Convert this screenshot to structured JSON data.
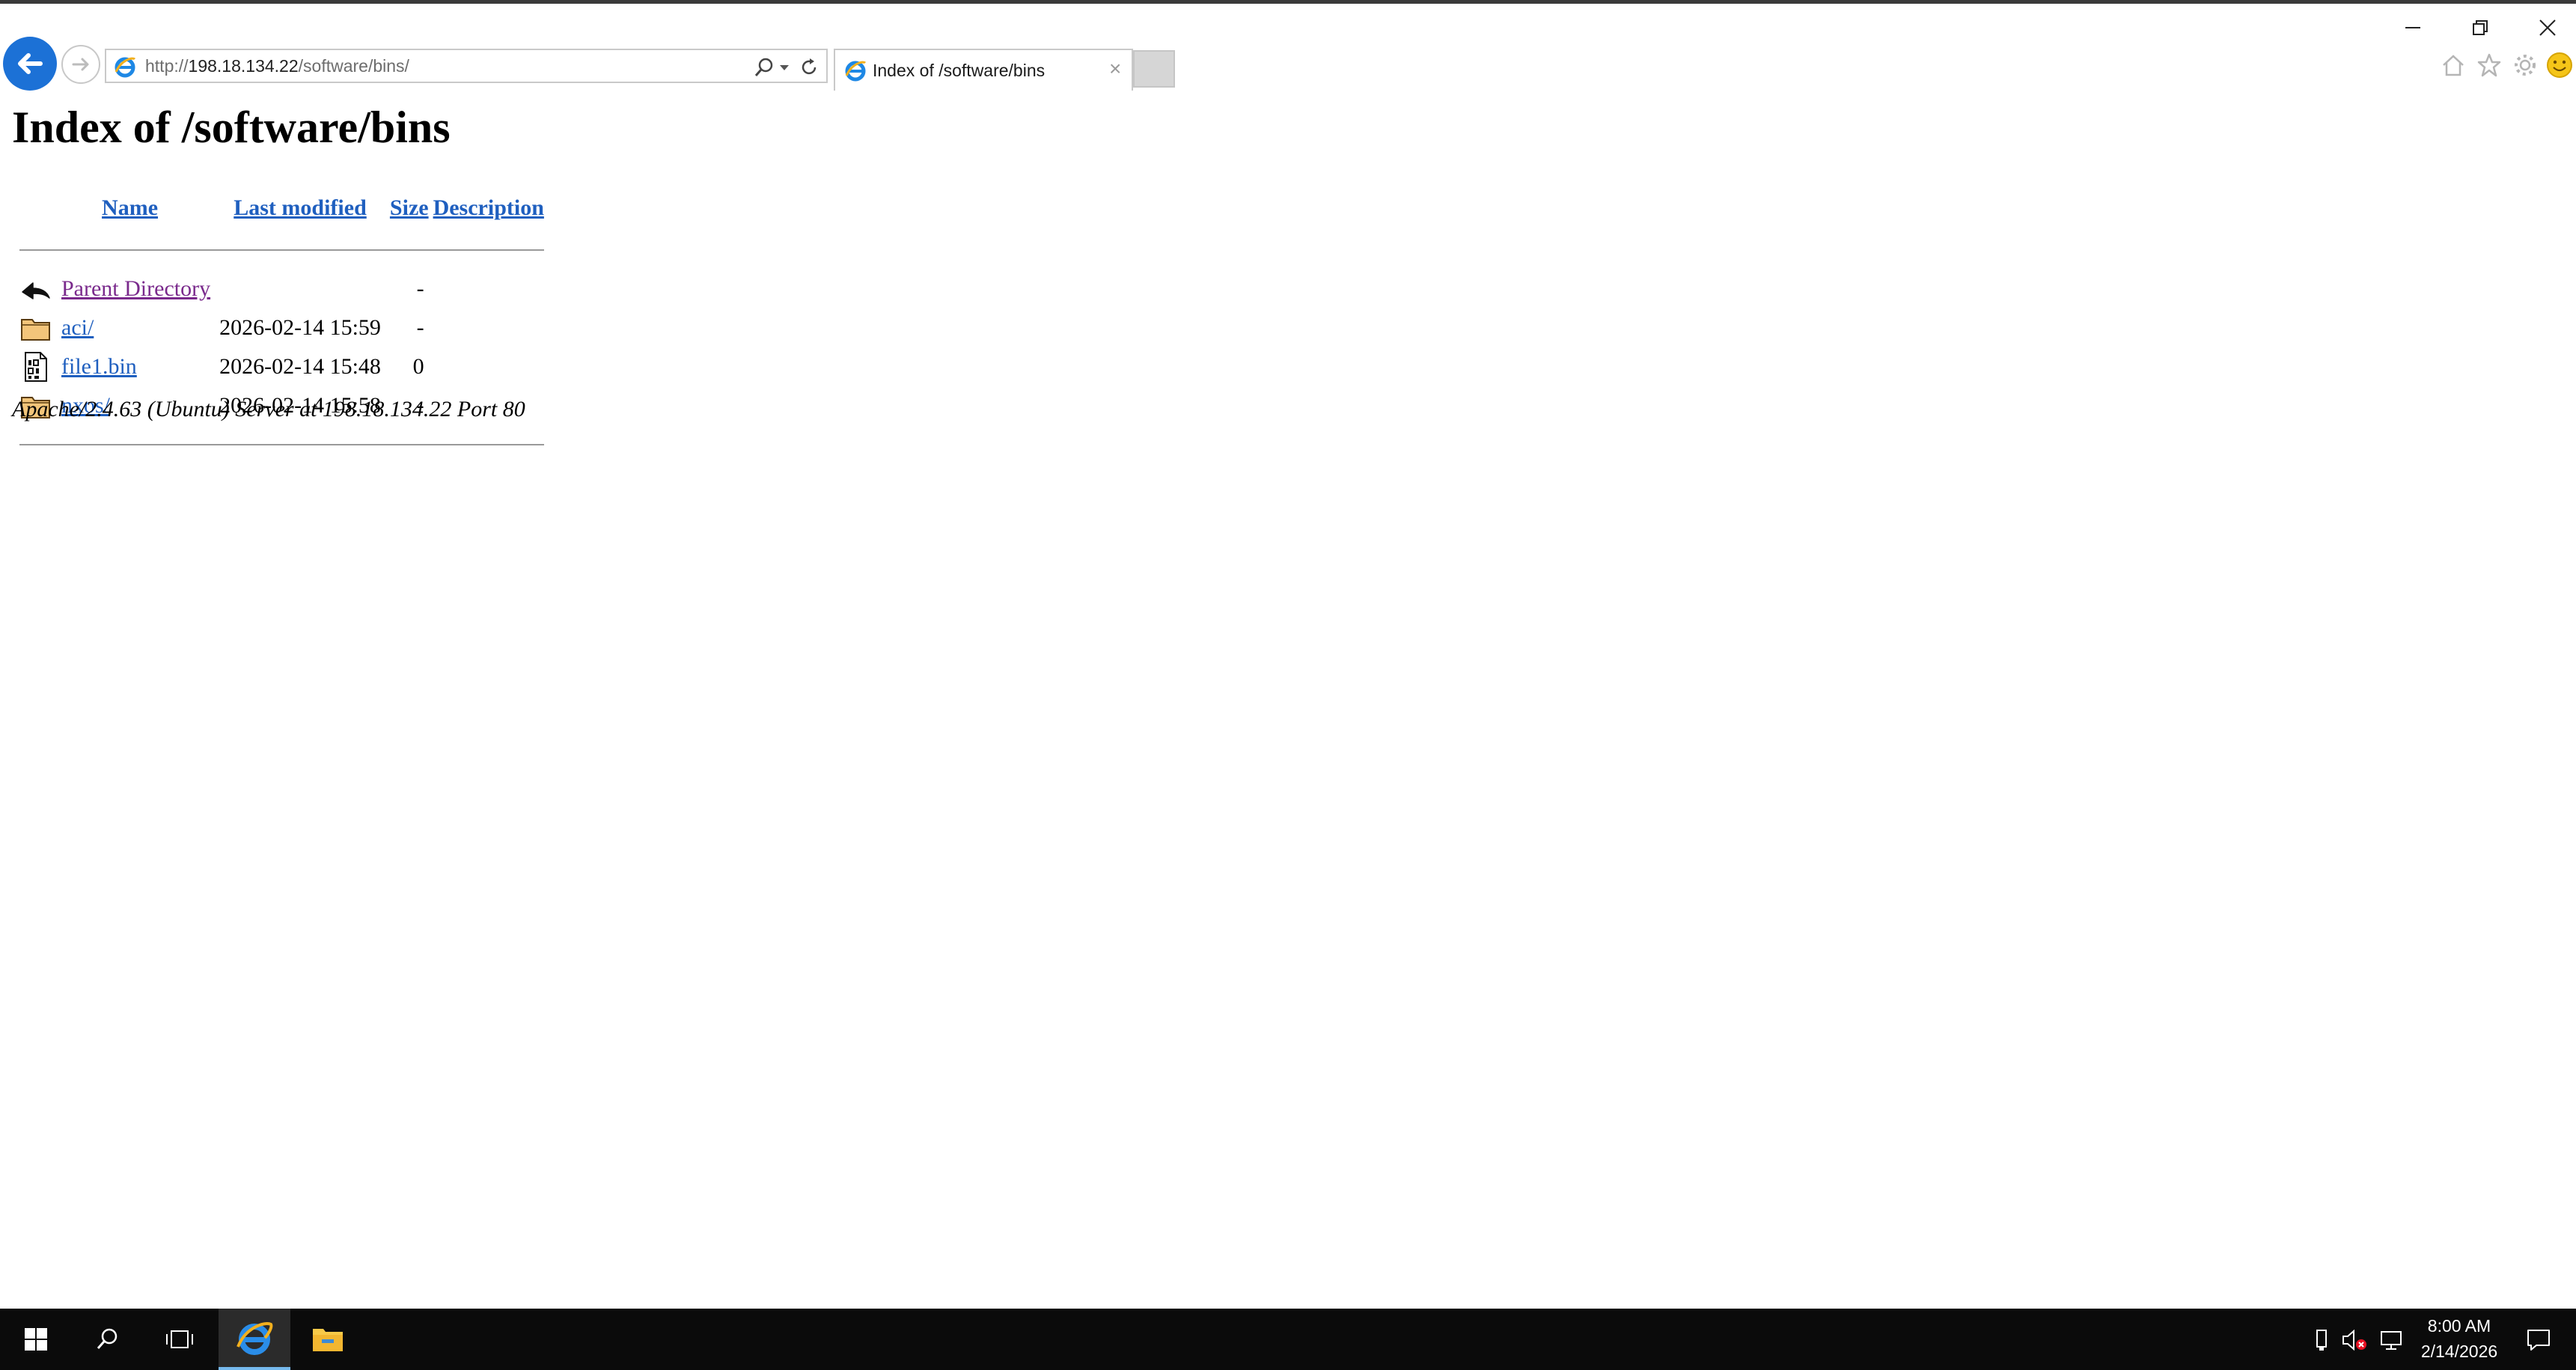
{
  "browser": {
    "url_prefix": "http://",
    "url_host": "198.18.134.22",
    "url_path": "/software/bins/",
    "tab_title": "Index of /software/bins",
    "tab_close": "×"
  },
  "page": {
    "heading": "Index of /software/bins",
    "columns": {
      "name": "Name",
      "last_modified": "Last modified",
      "size": "Size",
      "description": "Description"
    },
    "rows": [
      {
        "icon": "back-arrow-icon",
        "name": "Parent Directory",
        "modified": "",
        "size": "-"
      },
      {
        "icon": "folder-icon",
        "name": "aci/",
        "modified": "2026-02-14 15:59",
        "size": "-"
      },
      {
        "icon": "binary-file-icon",
        "name": "file1.bin",
        "modified": "2026-02-14 15:48",
        "size": "0"
      },
      {
        "icon": "folder-icon",
        "name": "nxos/",
        "modified": "2026-02-14 15:58",
        "size": "-"
      }
    ],
    "server_signature": "Apache/2.4.63 (Ubuntu) Server at 198.18.134.22 Port 80"
  },
  "taskbar": {
    "time": "8:00 AM",
    "date": "2/14/2026"
  },
  "colors": {
    "link": "#1f5fbf",
    "visited_link": "#7a2a8c",
    "back_button": "#1c71d6",
    "taskbar": "#0b0b0b"
  }
}
